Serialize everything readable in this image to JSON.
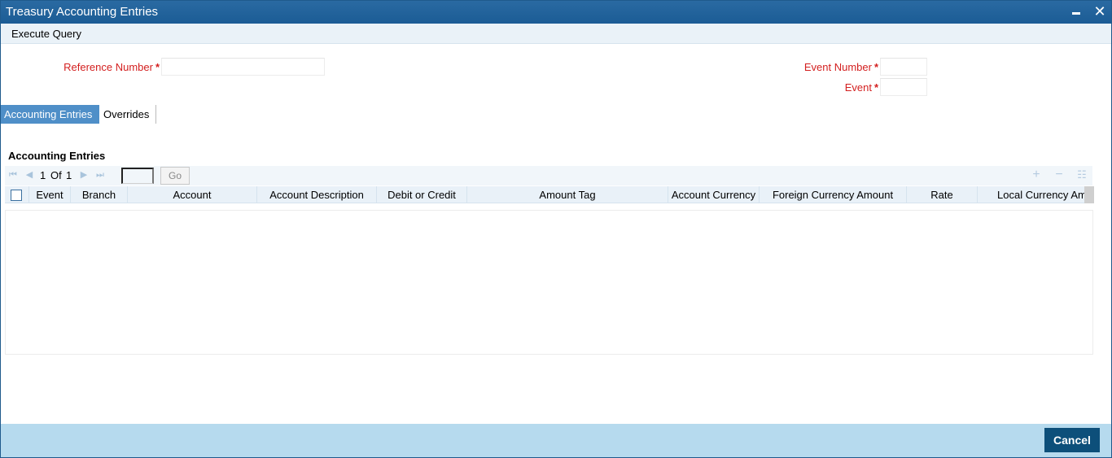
{
  "window": {
    "title": "Treasury Accounting Entries"
  },
  "menu": {
    "execute_query": "Execute Query"
  },
  "form": {
    "reference_number_label": "Reference Number",
    "event_number_label": "Event Number",
    "event_label": "Event",
    "required_marker": "*",
    "reference_number_value": "",
    "event_number_value": "",
    "event_value": ""
  },
  "tabs": [
    {
      "label": "Accounting Entries",
      "active": true
    },
    {
      "label": "Overrides",
      "active": false
    }
  ],
  "grid": {
    "section_title": "Accounting Entries",
    "pager": {
      "current": "1",
      "of": "Of",
      "total": "1",
      "go_label": "Go"
    },
    "columns": [
      "Event",
      "Branch",
      "Account",
      "Account Description",
      "Debit or Credit",
      "Amount Tag",
      "Account Currency",
      "Foreign Currency Amount",
      "Rate",
      "Local Currency Amount"
    ],
    "rows": []
  },
  "footer": {
    "cancel_label": "Cancel"
  },
  "colors": {
    "titlebar": "#1b5c95",
    "required_label": "#d31f1f",
    "active_tab": "#4f8fc8",
    "footer": "#b6daee",
    "cancel_button": "#0d4f7a"
  },
  "icons": [
    "minimize-icon",
    "close-icon",
    "first-page-icon",
    "prev-page-icon",
    "next-page-icon",
    "last-page-icon",
    "add-row-icon",
    "delete-row-icon",
    "single-view-icon"
  ]
}
